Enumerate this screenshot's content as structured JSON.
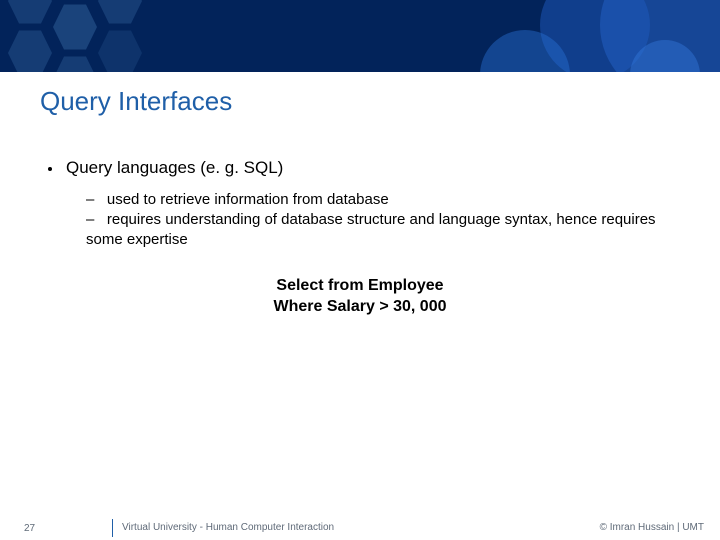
{
  "title": "Query Interfaces",
  "topic": "Query languages (e. g. SQL)",
  "sub1": "used to retrieve information from database",
  "sub2": "requires understanding of database structure and language syntax, hence requires some expertise",
  "code_line1": "Select from Employee",
  "code_line2": "Where Salary > 30, 000",
  "page_number": "27",
  "footer_center": "Virtual University - Human Computer Interaction",
  "footer_right": "© Imran Hussain | UMT"
}
